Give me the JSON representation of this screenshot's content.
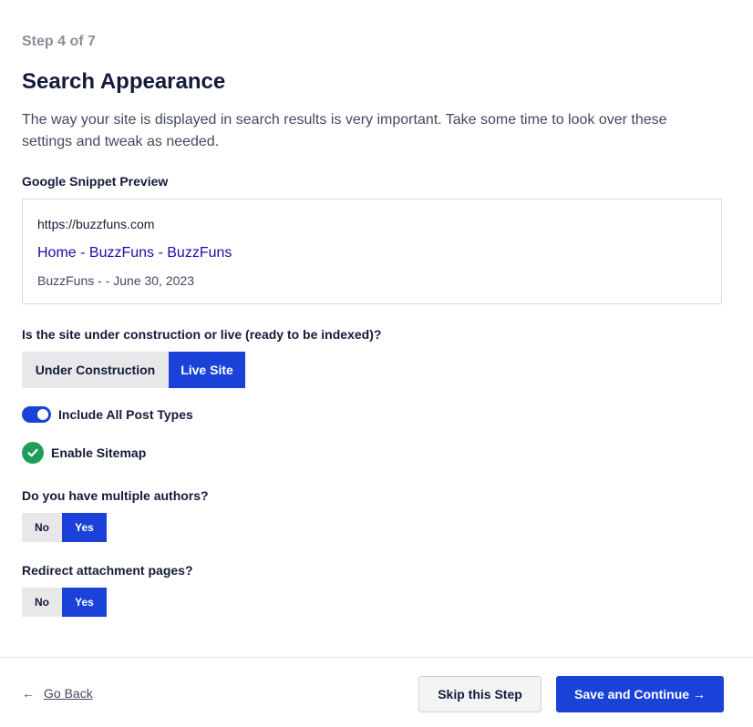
{
  "step": "Step 4 of 7",
  "title": "Search Appearance",
  "description": "The way your site is displayed in search results is very important. Take some time to look over these settings and tweak as needed.",
  "snippet": {
    "label": "Google Snippet Preview",
    "url": "https://buzzfuns.com",
    "title": "Home - BuzzFuns - BuzzFuns",
    "description": "BuzzFuns - - June 30, 2023"
  },
  "site_status": {
    "question": "Is the site under construction or live (ready to be indexed)?",
    "options": [
      "Under Construction",
      "Live Site"
    ],
    "selected": "Live Site"
  },
  "post_types": {
    "label": "Include All Post Types",
    "enabled": true
  },
  "sitemap": {
    "label": "Enable Sitemap",
    "enabled": true
  },
  "multiple_authors": {
    "question": "Do you have multiple authors?",
    "options": [
      "No",
      "Yes"
    ],
    "selected": "Yes"
  },
  "redirect_attachments": {
    "question": "Redirect attachment pages?",
    "options": [
      "No",
      "Yes"
    ],
    "selected": "Yes"
  },
  "footer": {
    "go_back_arrow": "←",
    "go_back": "Go Back",
    "skip": "Skip this Step",
    "save": "Save and Continue →"
  },
  "colors": {
    "accent": "#1a42d8",
    "success": "#1e9e5a",
    "link": "#1a0dab"
  }
}
